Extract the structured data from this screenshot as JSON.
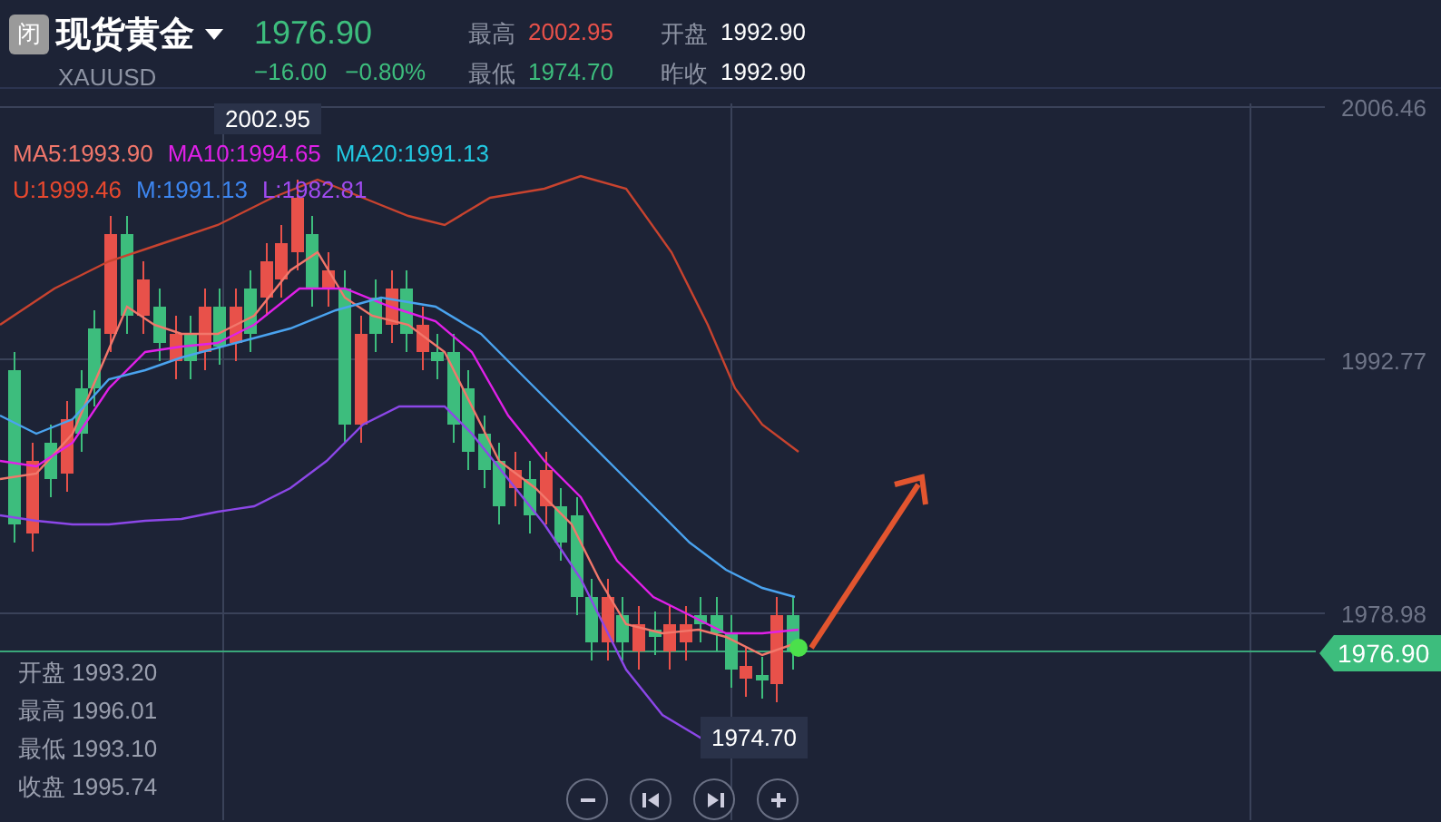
{
  "header": {
    "badge": "闭",
    "name": "现货黄金",
    "symbol": "XAUUSD",
    "price": "1976.90",
    "change": "−16.00",
    "change_pct": "−0.80%",
    "stats": [
      {
        "label": "最高",
        "value": "2002.95",
        "color": "#e8514a"
      },
      {
        "label": "开盘",
        "value": "1992.90",
        "color": "#ffffff"
      },
      {
        "label": "最低",
        "value": "1974.70",
        "color": "#3dbd7d"
      },
      {
        "label": "昨收",
        "value": "1992.90",
        "color": "#ffffff"
      }
    ]
  },
  "indicators": [
    [
      {
        "text": "MA5:1993.90",
        "color": "#f2776b"
      },
      {
        "text": "MA10:1994.65",
        "color": "#e020e8"
      },
      {
        "text": "MA20:1991.13",
        "color": "#22c8e0"
      }
    ],
    [
      {
        "text": "U:1999.46",
        "color": "#e8482e"
      },
      {
        "text": "M:1991.13",
        "color": "#3d86f0"
      },
      {
        "text": "L:1982.81",
        "color": "#a04bf0"
      }
    ]
  ],
  "high_marker": "2002.95",
  "low_marker": "1974.70",
  "axis_labels": [
    "2006.46",
    "1992.77",
    "1978.98"
  ],
  "current_price_tag": "1976.90",
  "ohlc": [
    {
      "label": "开盘",
      "value": "1993.20"
    },
    {
      "label": "最高",
      "value": "1996.01"
    },
    {
      "label": "最低",
      "value": "1993.10"
    },
    {
      "label": "收盘",
      "value": "1995.74"
    }
  ]
}
